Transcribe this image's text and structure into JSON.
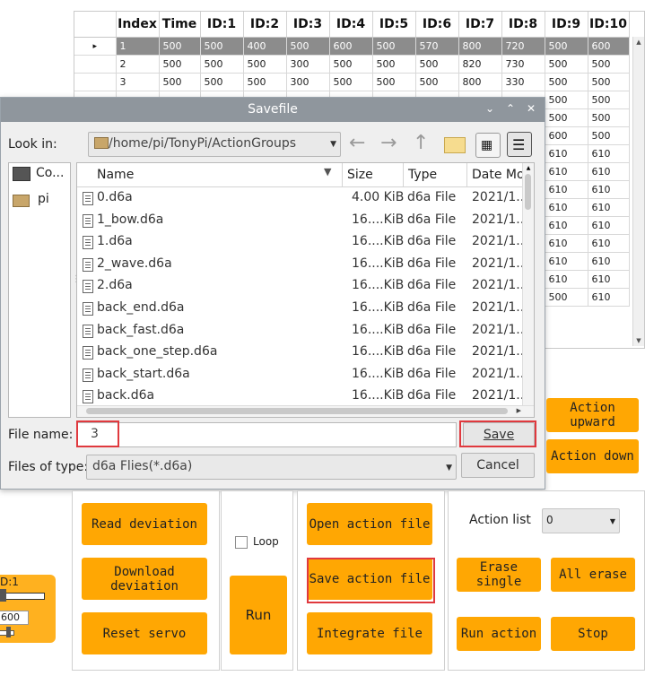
{
  "table": {
    "headers": [
      "Index",
      "Time",
      "ID:1",
      "ID:2",
      "ID:3",
      "ID:4",
      "ID:5",
      "ID:6",
      "ID:7",
      "ID:8",
      "ID:9",
      "ID:10"
    ],
    "rows": [
      [
        "1",
        "500",
        "500",
        "400",
        "500",
        "600",
        "500",
        "570",
        "800",
        "720",
        "500",
        "600"
      ],
      [
        "2",
        "500",
        "500",
        "500",
        "300",
        "500",
        "500",
        "500",
        "820",
        "730",
        "500",
        "500"
      ],
      [
        "3",
        "500",
        "500",
        "500",
        "300",
        "500",
        "500",
        "500",
        "800",
        "330",
        "500",
        "500"
      ]
    ],
    "id9_visible": [
      "500",
      "500",
      "500",
      "500",
      "500",
      "600",
      "610",
      "610",
      "610",
      "610",
      "610",
      "610",
      "610",
      "610",
      "500"
    ],
    "id10_visible": [
      "500",
      "500",
      "500",
      "500",
      "500",
      "500",
      "610",
      "610",
      "610",
      "610",
      "610",
      "610",
      "610",
      "610",
      "610"
    ],
    "selected_marker": "▸"
  },
  "dialog": {
    "title": "Savefile",
    "look_in_label": "Look in:",
    "path": "/home/pi/TonyPi/ActionGroups",
    "sidebar": [
      {
        "label": "Co...",
        "icon": "computer-icon"
      },
      {
        "label": "pi",
        "icon": "folder-icon"
      }
    ],
    "columns": {
      "name": "Name",
      "size": "Size",
      "type": "Type",
      "date": "Date Mo"
    },
    "files": [
      {
        "name": "0.d6a",
        "size": "4.00 KiB",
        "type": "d6a File",
        "date": "2021/1..."
      },
      {
        "name": "1_bow.d6a",
        "size": "16....KiB",
        "type": "d6a File",
        "date": "2021/1..."
      },
      {
        "name": "1.d6a",
        "size": "16....KiB",
        "type": "d6a File",
        "date": "2021/1..."
      },
      {
        "name": "2_wave.d6a",
        "size": "16....KiB",
        "type": "d6a File",
        "date": "2021/1..."
      },
      {
        "name": "2.d6a",
        "size": "16....KiB",
        "type": "d6a File",
        "date": "2021/1..."
      },
      {
        "name": "back_end.d6a",
        "size": "16....KiB",
        "type": "d6a File",
        "date": "2021/1..."
      },
      {
        "name": "back_fast.d6a",
        "size": "16....KiB",
        "type": "d6a File",
        "date": "2021/1..."
      },
      {
        "name": "back_one_step.d6a",
        "size": "16....KiB",
        "type": "d6a File",
        "date": "2021/1..."
      },
      {
        "name": "back_start.d6a",
        "size": "16....KiB",
        "type": "d6a File",
        "date": "2021/1..."
      },
      {
        "name": "back.d6a",
        "size": "16....KiB",
        "type": "d6a File",
        "date": "2021/1..."
      }
    ],
    "file_name_label": "File name:",
    "file_name_value": "3",
    "files_of_type_label": "Files of type:",
    "files_of_type_value": "d6a Flies(*.d6a)",
    "save_label": "Save",
    "cancel_label": "Cancel"
  },
  "buttons": {
    "read_deviation": "Read deviation",
    "download_deviation": "Download deviation",
    "reset_servo": "Reset servo",
    "loop_label": "Loop",
    "run": "Run",
    "open_action_file": "Open action file",
    "save_action_file": "Save action file",
    "integrate_file": "Integrate file",
    "action_list_label": "Action list",
    "action_list_value": "0",
    "erase_single": "Erase single",
    "all_erase": "All erase",
    "run_action": "Run action",
    "stop": "Stop",
    "action_upward": "Action upward",
    "action_down": "Action down"
  },
  "servo_widget": {
    "id_label": "D:1",
    "value": "600"
  },
  "colors": {
    "accent": "#ffa703",
    "highlight": "#e0393e",
    "selected_row": "#8c8c8c"
  }
}
